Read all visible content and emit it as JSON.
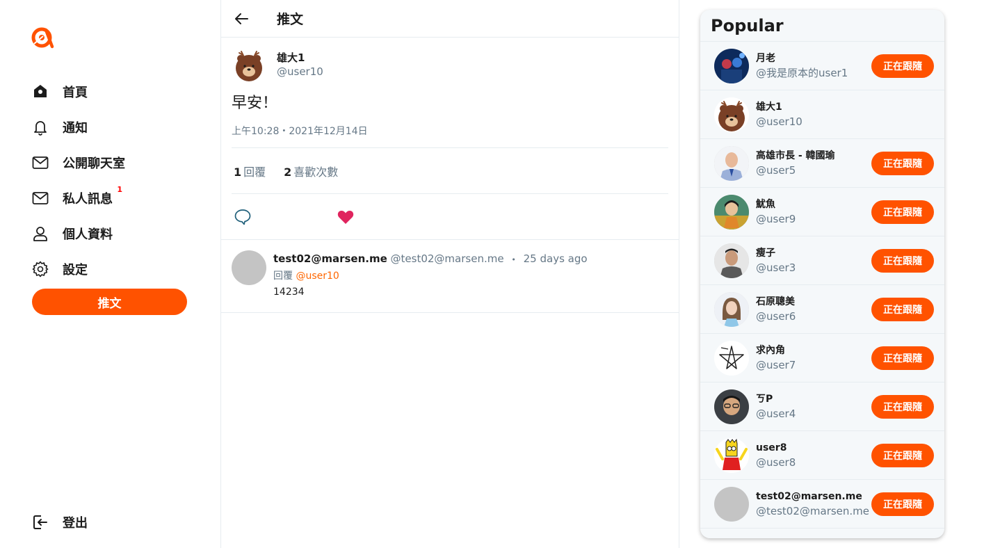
{
  "sidebar": {
    "items": [
      {
        "label": "首頁",
        "icon": "home-icon"
      },
      {
        "label": "通知",
        "icon": "bell-icon"
      },
      {
        "label": "公開聊天室",
        "icon": "mail-icon"
      },
      {
        "label": "私人訊息",
        "icon": "mail-icon",
        "badge": "1"
      },
      {
        "label": "個人資料",
        "icon": "user-icon"
      },
      {
        "label": "設定",
        "icon": "gear-icon"
      }
    ],
    "tweet_button": "推文",
    "logout_label": "登出"
  },
  "header": {
    "title": "推文"
  },
  "tweet": {
    "author_name": "雄大1",
    "author_handle": "@user10",
    "content": "早安！",
    "time": "上午10:28・2021年12月14日",
    "reply_count": "1",
    "reply_label": "回覆",
    "like_count": "2",
    "like_label": "喜歡次數"
  },
  "replies": [
    {
      "name": "test02@marsen.me",
      "handle": "@test02@marsen.me",
      "separator": "•",
      "time": "25 days ago",
      "reply_prefix": "回覆",
      "reply_to": "@user10",
      "text": "14234"
    }
  ],
  "popular": {
    "title": "Popular",
    "follow_label": "正在跟隨",
    "users": [
      {
        "name": "月老",
        "handle": "@我是原本的user1",
        "following": true
      },
      {
        "name": "雄大1",
        "handle": "@user10",
        "following": false
      },
      {
        "name": "高雄市長 - 韓國瑜",
        "handle": "@user5",
        "following": true
      },
      {
        "name": "魷魚",
        "handle": "@user9",
        "following": true
      },
      {
        "name": "瘦子",
        "handle": "@user3",
        "following": true
      },
      {
        "name": "石原聰美",
        "handle": "@user6",
        "following": true
      },
      {
        "name": "求內角",
        "handle": "@user7",
        "following": true
      },
      {
        "name": "ㄎP",
        "handle": "@user4",
        "following": true
      },
      {
        "name": "user8",
        "handle": "@user8",
        "following": true
      },
      {
        "name": "test02@marsen.me",
        "handle": "@test02@marsen.me",
        "following": true
      }
    ]
  },
  "colors": {
    "accent": "#ff5200",
    "like": "#e0245e",
    "muted": "#657786",
    "mention": "#ff6600"
  }
}
